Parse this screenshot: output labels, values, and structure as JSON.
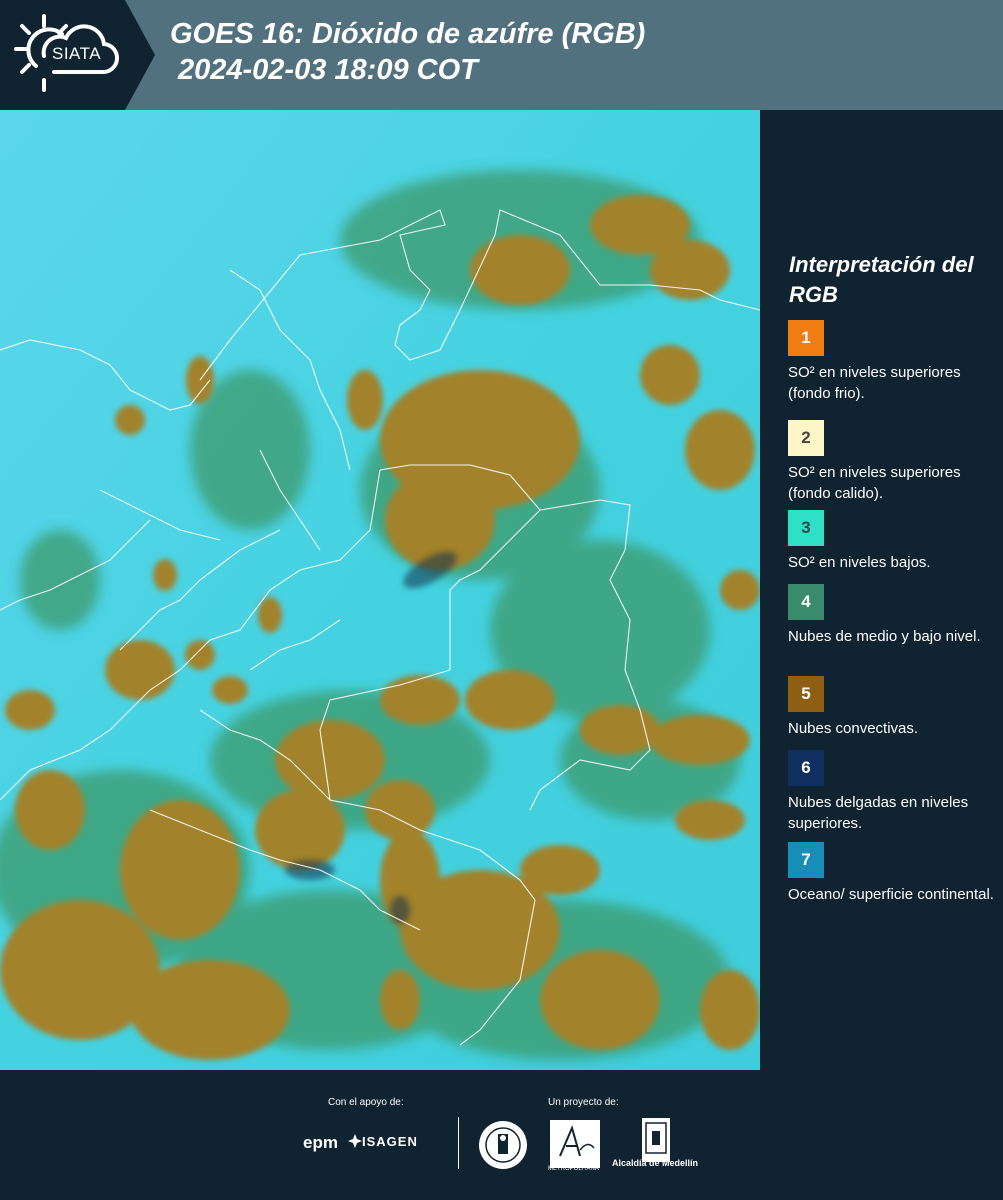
{
  "header": {
    "logo_text": "SIATA",
    "title_line1": "GOES 16: Dióxido de azúfre (RGB)",
    "title_line2": "2024-02-03 18:09 COT"
  },
  "map": {
    "background_color": "#3fd0de",
    "cloud_color": "#a2822c",
    "low_cloud_color": "#3c9a6a",
    "border_color": "#ffffff"
  },
  "legend": {
    "title": "Interpretación del RGB",
    "items": [
      {
        "number": "1",
        "color": "#f07c12",
        "text_color": "#ffffff",
        "label": "SO² en niveles superiores (fondo frio)."
      },
      {
        "number": "2",
        "color": "#fdf6c6",
        "text_color": "#444444",
        "label": "SO² en niveles superiores (fondo calido)."
      },
      {
        "number": "3",
        "color": "#2de0c6",
        "text_color": "#2a4a4a",
        "label": "SO² en niveles bajos."
      },
      {
        "number": "4",
        "color": "#3a8a6c",
        "text_color": "#ffffff",
        "label": "Nubes de medio y bajo nivel."
      },
      {
        "number": "5",
        "color": "#8e5e12",
        "text_color": "#ffffff",
        "label": "Nubes convectivas."
      },
      {
        "number": "6",
        "color": "#0f2f5e",
        "text_color": "#ffffff",
        "label": "Nubes delgadas en niveles superiores."
      },
      {
        "number": "7",
        "color": "#168eb8",
        "text_color": "#ffffff",
        "label": "Oceano/ superficie continental."
      }
    ]
  },
  "footer": {
    "support_label": "Con el apoyo de:",
    "project_label": "Un proyecto de:",
    "epm": "epm",
    "isagen": "ISAGEN",
    "area_text": "METROPOLITANA",
    "alcaldia": "Alcaldía de Medellín"
  }
}
